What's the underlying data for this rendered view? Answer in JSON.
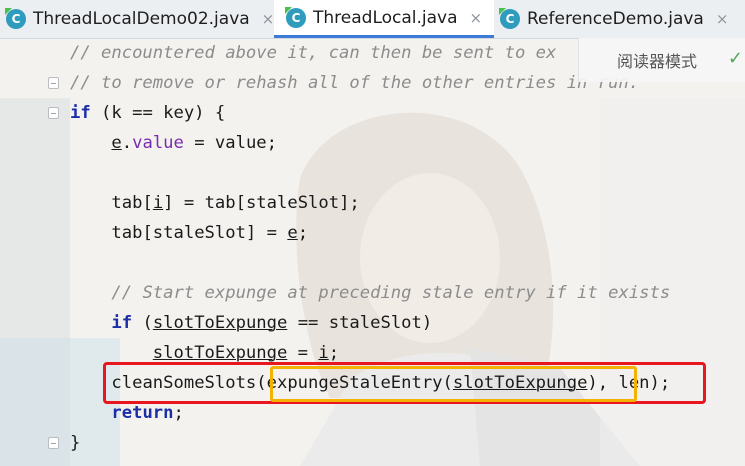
{
  "tabs": [
    {
      "label": "ThreadLocalDemo02.java",
      "close": "×",
      "icon": "class-c-icon",
      "active": false
    },
    {
      "label": "ThreadLocal.java",
      "close": "×",
      "icon": "class-c-icon",
      "active": true
    },
    {
      "label": "ReferenceDemo.java",
      "close": "×",
      "icon": "class-c-icon",
      "active": false
    }
  ],
  "reader_mode": {
    "label": "阅读器模式",
    "check": "✓"
  },
  "code_lines": [
    {
      "indent": "",
      "tokens": [
        {
          "t": "cm",
          "v": "// encountered above it, can then be sent to ex"
        }
      ]
    },
    {
      "indent": "",
      "tokens": [
        {
          "t": "cm",
          "v": "// to remove or rehash all of the other entries in run."
        }
      ]
    },
    {
      "indent": "",
      "tokens": [
        {
          "t": "kw",
          "v": "if"
        },
        {
          "t": "tx",
          "v": " (k == key) {"
        }
      ]
    },
    {
      "indent": "    ",
      "tokens": [
        {
          "t": "ul",
          "v": "e"
        },
        {
          "t": "tx",
          "v": "."
        },
        {
          "t": "fld",
          "v": "value"
        },
        {
          "t": "tx",
          "v": " = value;"
        }
      ]
    },
    {
      "indent": "",
      "tokens": []
    },
    {
      "indent": "    ",
      "tokens": [
        {
          "t": "tx",
          "v": "tab["
        },
        {
          "t": "ul",
          "v": "i"
        },
        {
          "t": "tx",
          "v": "] = tab[staleSlot];"
        }
      ]
    },
    {
      "indent": "    ",
      "tokens": [
        {
          "t": "tx",
          "v": "tab[staleSlot] = "
        },
        {
          "t": "ul",
          "v": "e"
        },
        {
          "t": "tx",
          "v": ";"
        }
      ]
    },
    {
      "indent": "",
      "tokens": []
    },
    {
      "indent": "    ",
      "tokens": [
        {
          "t": "cm",
          "v": "// Start expunge at preceding stale entry if it exists"
        }
      ]
    },
    {
      "indent": "    ",
      "tokens": [
        {
          "t": "kw",
          "v": "if"
        },
        {
          "t": "tx",
          "v": " ("
        },
        {
          "t": "ul",
          "v": "slotToExpunge"
        },
        {
          "t": "tx",
          "v": " == staleSlot)"
        }
      ]
    },
    {
      "indent": "        ",
      "tokens": [
        {
          "t": "ul",
          "v": "slotToExpunge"
        },
        {
          "t": "tx",
          "v": " = "
        },
        {
          "t": "ul",
          "v": "i"
        },
        {
          "t": "tx",
          "v": ";"
        }
      ]
    },
    {
      "indent": "    ",
      "tokens": [
        {
          "t": "tx",
          "v": "cleanSomeSlots(expungeStaleEntry("
        },
        {
          "t": "ul",
          "v": "slotToExpunge"
        },
        {
          "t": "tx",
          "v": "), len);"
        }
      ]
    },
    {
      "indent": "    ",
      "tokens": [
        {
          "t": "kw",
          "v": "return"
        },
        {
          "t": "tx",
          "v": ";"
        }
      ]
    },
    {
      "indent": "",
      "tokens": [
        {
          "t": "tx",
          "v": "}"
        }
      ]
    }
  ],
  "colors": {
    "keyword": "#1a2ea8",
    "comment": "#8c8c8c",
    "field": "#7a2bb0",
    "highlight_outer": "#e8161f",
    "highlight_inner": "#f4b100"
  }
}
